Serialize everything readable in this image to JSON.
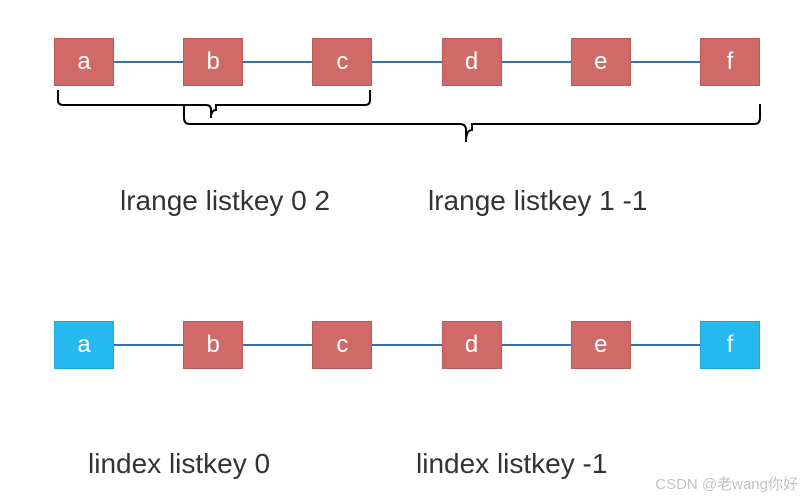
{
  "diagram1": {
    "nodes": [
      {
        "label": "a",
        "color": "red"
      },
      {
        "label": "b",
        "color": "red"
      },
      {
        "label": "c",
        "color": "red"
      },
      {
        "label": "d",
        "color": "red"
      },
      {
        "label": "e",
        "color": "red"
      },
      {
        "label": "f",
        "color": "red"
      }
    ],
    "commands": {
      "left": "lrange  listkey 0 2",
      "right": "lrange  listkey 1 -1"
    },
    "braces": [
      {
        "name": "brace-0-2",
        "start_index": 0,
        "end_index": 2
      },
      {
        "name": "brace-1-5",
        "start_index": 1,
        "end_index": 5
      }
    ]
  },
  "diagram2": {
    "nodes": [
      {
        "label": "a",
        "color": "blue"
      },
      {
        "label": "b",
        "color": "red"
      },
      {
        "label": "c",
        "color": "red"
      },
      {
        "label": "d",
        "color": "red"
      },
      {
        "label": "e",
        "color": "red"
      },
      {
        "label": "f",
        "color": "blue"
      }
    ],
    "commands": {
      "left": "lindex listkey 0",
      "right": "lindex listkey -1"
    }
  },
  "colors": {
    "red_fill": "#cf6a68",
    "blue_fill": "#26b9ef",
    "link": "#2e74b5",
    "text": "#333333"
  },
  "watermark": "CSDN @老wang你好"
}
